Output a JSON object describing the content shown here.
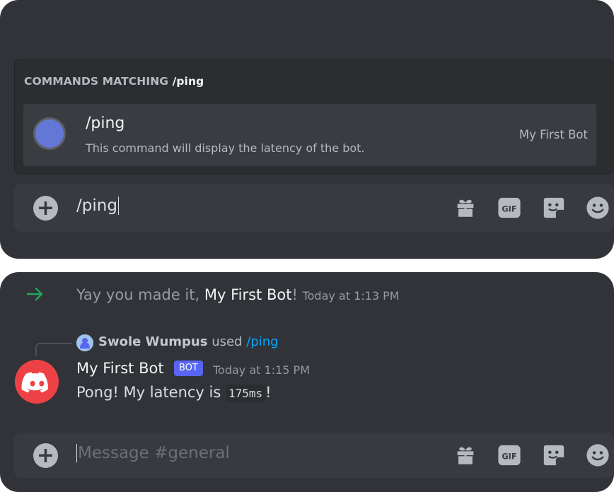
{
  "autocomplete": {
    "title_prefix": "COMMANDS MATCHING",
    "title_query": "/ping",
    "command": {
      "name": "/ping",
      "description": "This command will display the latency of the bot.",
      "source": "My First Bot"
    }
  },
  "composer_top": {
    "value": "/ping"
  },
  "system_message": {
    "text_before": "Yay you made it,",
    "username": "My First Bot",
    "text_after": "!",
    "timestamp": "Today at 1:13 PM"
  },
  "reply": {
    "username": "Swole Wumpus",
    "used": "used",
    "command": "/ping"
  },
  "bot_message": {
    "author": "My First Bot",
    "tag": "BOT",
    "timestamp": "Today at 1:15 PM",
    "text_before": "Pong! My latency is",
    "code": "175ms",
    "text_after": "!"
  },
  "composer_bottom": {
    "placeholder": "Message #general"
  },
  "toolbar": {
    "gif_label": "GIF"
  },
  "colors": {
    "background": "#313338",
    "composer": "#383a40",
    "accent": "#5865f2",
    "bot_avatar": "#ed4245",
    "join_arrow": "#23a55a",
    "link": "#00a8fc"
  }
}
